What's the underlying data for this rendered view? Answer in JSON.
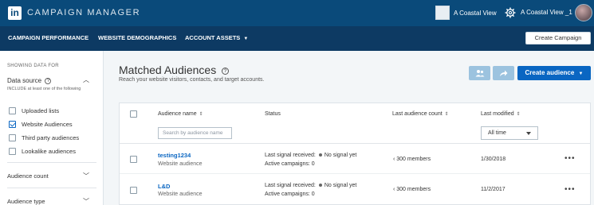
{
  "topbar": {
    "logo": "in",
    "app_title": "CAMPAIGN MANAGER",
    "account_1": "A Coastal View",
    "account_2": "A Coastal View _1",
    "icons": [
      "linkedin-logo",
      "account-thumbnail",
      "gear-icon",
      "avatar"
    ]
  },
  "nav": {
    "items": [
      "CAMPAIGN PERFORMANCE",
      "WEBSITE DEMOGRAPHICS",
      "ACCOUNT ASSETS"
    ],
    "create_campaign": "Create Campaign"
  },
  "sidebar": {
    "showing_for": "SHOWING DATA FOR",
    "data_source": "Data source",
    "include_note": "INCLUDE at least one of the following",
    "options": [
      {
        "label": "Uploaded lists",
        "checked": false
      },
      {
        "label": "Website Audiences",
        "checked": true
      },
      {
        "label": "Third party audiences",
        "checked": false
      },
      {
        "label": "Lookalike audiences",
        "checked": false
      }
    ],
    "sections": [
      "Audience count",
      "Audience type"
    ]
  },
  "main": {
    "title": "Matched Audiences",
    "subtitle": "Reach your website visitors, contacts, and target accounts.",
    "create_audience": "Create audience",
    "columns": [
      "Audience name",
      "Status",
      "Last audience count",
      "Last modified"
    ],
    "search_placeholder": "Search by audience name",
    "time_filter": "All time",
    "rows": [
      {
        "name": "testing1234",
        "type": "Website audience",
        "signal_label": "Last signal received:",
        "signal_value": "No signal yet",
        "campaigns": "Active campaigns: 0",
        "count": "‹ 300 members",
        "modified": "1/30/2018"
      },
      {
        "name": "L&D",
        "type": "Website audience",
        "signal_label": "Last signal received:",
        "signal_value": "No signal yet",
        "campaigns": "Active campaigns: 0",
        "count": "‹ 300 members",
        "modified": "11/2/2017"
      }
    ]
  },
  "colors": {
    "topbar": "#0a4a7a",
    "navbar": "#0d3a63",
    "accent": "#0a66c2",
    "disabled_button": "#9cc3df"
  }
}
